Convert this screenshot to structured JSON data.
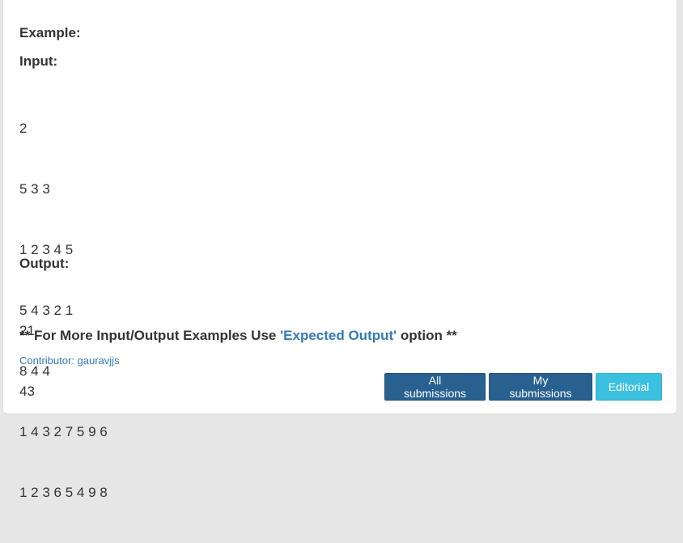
{
  "problem": {
    "example_heading": "Example:",
    "input_heading": "Input:",
    "input_lines": [
      "2",
      "5 3 3",
      "1 2 3 4 5",
      "5 4 3 2 1",
      "8 4 4",
      "1 4 3 2 7 5 9 6",
      "1 2 3 6 5 4 9 8"
    ],
    "output_heading": "Output:",
    "output_lines": [
      "21",
      "43"
    ],
    "more_prefix": "** For More Input/Output Examples Use ",
    "more_link": "'Expected Output'",
    "more_suffix": " option **",
    "contributor_label": "Contributor: ",
    "contributor_name": "gauravjjs"
  },
  "actions": {
    "all_submissions": "All submissions",
    "my_submissions": "My submissions",
    "editorial": "Editorial"
  },
  "colors": {
    "primary": "#286090",
    "info": "#3bc0e0",
    "link": "#337ab7"
  }
}
